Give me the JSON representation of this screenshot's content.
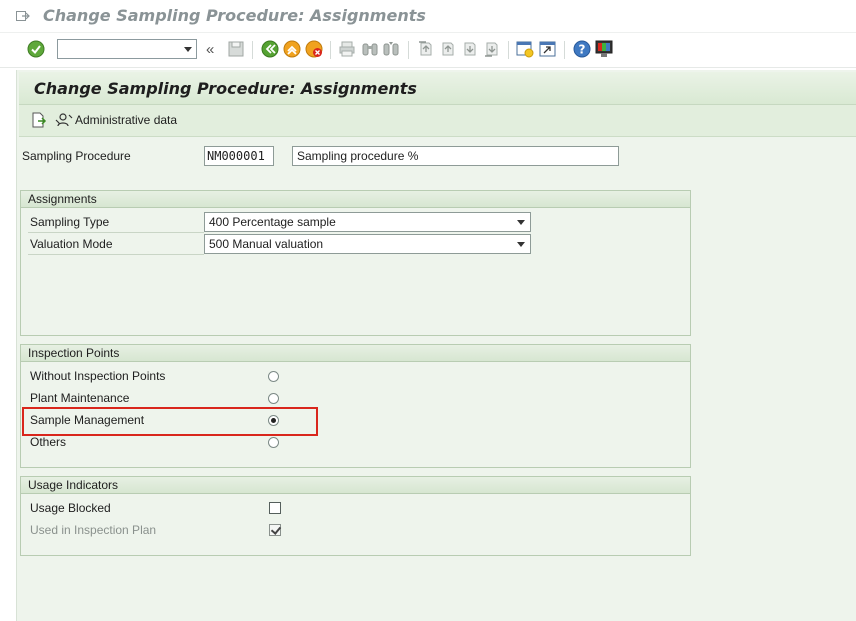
{
  "window": {
    "title": "Change Sampling Procedure: Assignments"
  },
  "toolbar": {
    "command_field": {
      "value": "",
      "placeholder": ""
    },
    "icons": [
      "enter-icon",
      "command-field-dropdown-icon",
      "collapse-icon",
      "save-icon",
      "back-icon",
      "exit-icon",
      "cancel-icon",
      "print-icon",
      "find-icon",
      "find-next-icon",
      "first-page-icon",
      "previous-page-icon",
      "next-page-icon",
      "last-page-icon",
      "create-session-icon",
      "shortcut-icon",
      "help-icon",
      "customize-layout-icon"
    ]
  },
  "screen": {
    "title": "Change Sampling Procedure: Assignments",
    "app_toolbar": {
      "other_object_icon": "other-object-icon",
      "admin_button": "Administrative data"
    }
  },
  "header_fields": {
    "procedure_label": "Sampling Procedure",
    "procedure_value": "NM000001",
    "procedure_description": "Sampling procedure %"
  },
  "assignments": {
    "title": "Assignments",
    "sampling_type_label": "Sampling Type",
    "sampling_type_value": "400 Percentage sample",
    "valuation_mode_label": "Valuation Mode",
    "valuation_mode_value": "500 Manual valuation"
  },
  "inspection_points": {
    "title": "Inspection Points",
    "options": [
      {
        "label": "Without Inspection Points",
        "selected": false
      },
      {
        "label": "Plant Maintenance",
        "selected": false
      },
      {
        "label": "Sample Management",
        "selected": true
      },
      {
        "label": "Others",
        "selected": false
      }
    ]
  },
  "usage_indicators": {
    "title": "Usage Indicators",
    "blocked_label": "Usage Blocked",
    "blocked_checked": false,
    "in_plan_label": "Used in Inspection Plan",
    "in_plan_checked": true
  },
  "colors": {
    "highlight": "#d9261c",
    "screen_bg": "#eef4ec",
    "header_bg": "#d9e9d3"
  }
}
